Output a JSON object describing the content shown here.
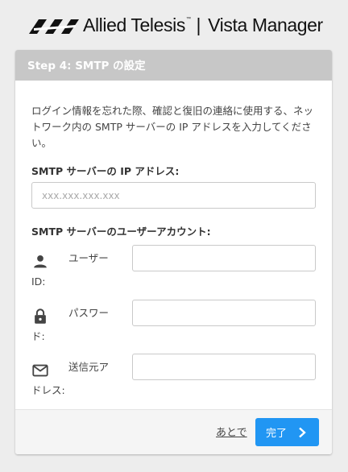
{
  "brand": {
    "name": "Allied Telesis",
    "trademark": "™",
    "separator": "|",
    "product": "Vista Manager"
  },
  "dialog": {
    "title": "Step 4: SMTP の設定",
    "description": "ログイン情報を忘れた際、確認と復旧の連絡に使用する、ネットワーク内の SMTP サーバーの IP アドレスを入力してください。",
    "ip_label": "SMTP サーバーの IP アドレス:",
    "ip_placeholder": "xxx.xxx.xxx.xxx",
    "ip_value": "",
    "account_label": "SMTP サーバーのユーザーアカウント:",
    "fields": [
      {
        "label_line1": "ユーザー",
        "label_line2": "ID:",
        "icon": "person-icon",
        "value": ""
      },
      {
        "label_line1": "パスワー",
        "label_line2": "ド:",
        "icon": "lock-icon",
        "value": ""
      },
      {
        "label_line1": "送信元ア",
        "label_line2": "ドレス:",
        "icon": "mail-icon",
        "value": ""
      }
    ]
  },
  "footer": {
    "later_label": "あとで",
    "finish_label": "完了"
  },
  "colors": {
    "header_bar": "#c7c7c7",
    "primary": "#2196f3",
    "background": "#ededed"
  }
}
